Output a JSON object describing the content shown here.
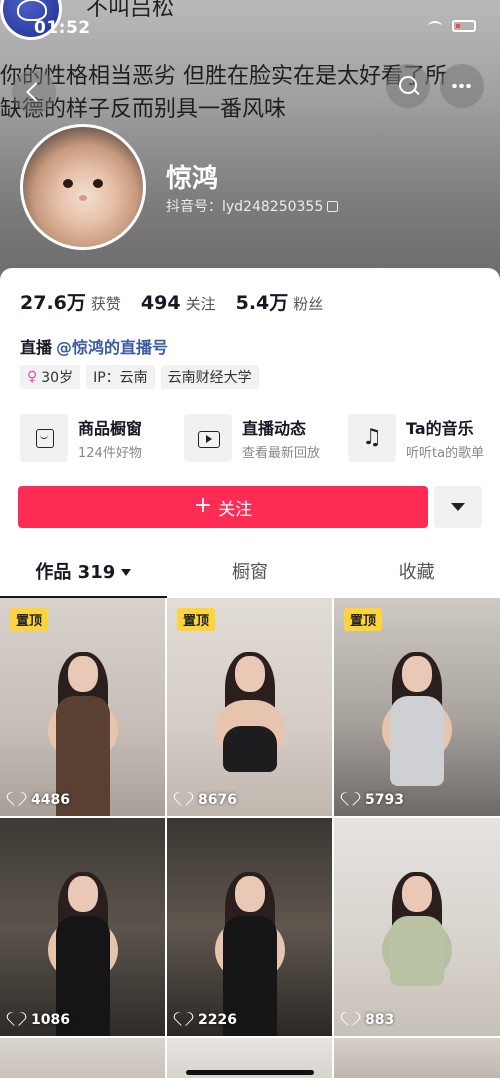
{
  "status_bar": {
    "time": "01:52"
  },
  "header": {
    "top_name": "不叫吕松",
    "signature_line1": "你的性格相当恶劣 但胜在脸实在是太好看了所",
    "signature_line2": "缺德的样子反而别具一番风味"
  },
  "profile": {
    "nickname": "惊鸿",
    "douyin_id": "抖音号：lyd248250355"
  },
  "stats": [
    {
      "value": "27.6万",
      "label": "获赞"
    },
    {
      "value": "494",
      "label": "关注"
    },
    {
      "value": "5.4万",
      "label": "粉丝"
    }
  ],
  "live": {
    "prefix": "直播",
    "link": "@惊鸿的直播号"
  },
  "tags": [
    {
      "label": "30岁",
      "icon": "female-icon"
    },
    {
      "label": "IP：云南"
    },
    {
      "label": "云南财经大学"
    }
  ],
  "features": [
    {
      "title": "商品橱窗",
      "subtitle": "124件好物",
      "icon": "shopping-bag-icon"
    },
    {
      "title": "直播动态",
      "subtitle": "查看最新回放",
      "icon": "tv-icon"
    },
    {
      "title": "Ta的音乐",
      "subtitle": "听听ta的歌单",
      "icon": "music-note-icon"
    }
  ],
  "actions": {
    "follow_label": "关注",
    "follow_icon": "+"
  },
  "tabs": [
    {
      "label": "作品 319",
      "active": true
    },
    {
      "label": "橱窗"
    },
    {
      "label": "收藏"
    }
  ],
  "videos": [
    {
      "likes": "4486",
      "pinned": "置顶"
    },
    {
      "likes": "8676",
      "pinned": "置顶"
    },
    {
      "likes": "5793",
      "pinned": "置顶"
    },
    {
      "likes": "1086"
    },
    {
      "likes": "2226"
    },
    {
      "likes": "883"
    }
  ],
  "colors": {
    "primary": "#fe2c55",
    "link": "#3c5ba4",
    "pin_badge": "#fdd43b"
  }
}
